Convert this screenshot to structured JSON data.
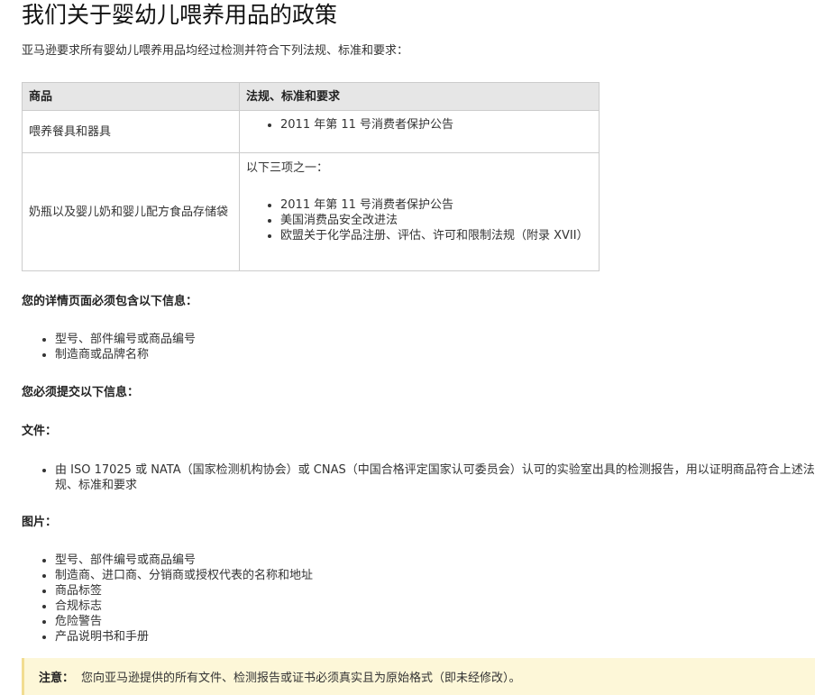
{
  "title": "我们关于婴幼儿喂养用品的政策",
  "intro": "亚马逊要求所有婴幼儿喂养用品均经过检测并符合下列法规、标准和要求：",
  "table": {
    "headers": [
      "商品",
      "法规、标准和要求"
    ],
    "rows": [
      {
        "product": "喂养餐具和器具",
        "lead": "",
        "items": [
          "2011 年第 11 号消费者保护公告"
        ]
      },
      {
        "product": "奶瓶以及婴儿奶和婴儿配方食品存储袋",
        "lead": "以下三项之一：",
        "items": [
          "2011 年第 11 号消费者保护公告",
          "美国消费品安全改进法",
          "欧盟关于化学品注册、评估、许可和限制法规（附录 XVII）"
        ]
      }
    ]
  },
  "detail_heading": "您的详情页面必须包含以下信息：",
  "detail_items": [
    "型号、部件编号或商品编号",
    "制造商或品牌名称"
  ],
  "submit_heading": "您必须提交以下信息：",
  "docs_heading": "文件：",
  "docs_items": [
    "由 ISO 17025 或 NATA（国家检测机构协会）或 CNAS（中国合格评定国家认可委员会）认可的实验室出具的检测报告，用以证明商品符合上述法规、标准和要求"
  ],
  "images_heading": "图片：",
  "images_items": [
    "型号、部件编号或商品编号",
    "制造商、进口商、分销商或授权代表的名称和地址",
    "商品标签",
    "合规标志",
    "危险警告",
    "产品说明书和手册"
  ],
  "note": {
    "label": "注意：",
    "text": "您向亚马逊提供的所有文件、检测报告或证书必须真实且为原始格式（即未经修改）。"
  }
}
